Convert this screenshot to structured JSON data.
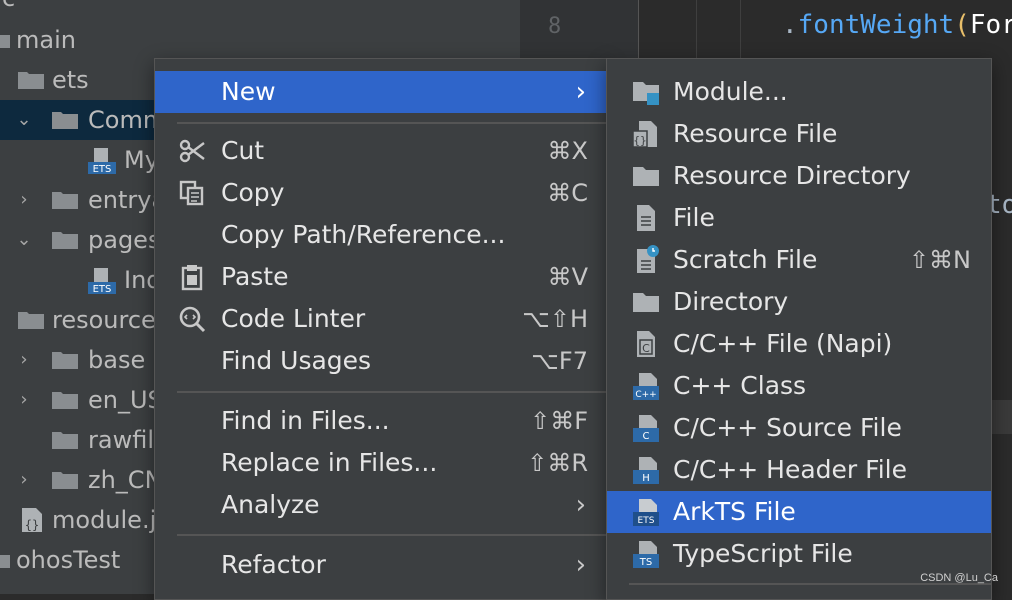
{
  "tree": {
    "top_partial": "c",
    "main": "main",
    "ets": "ets",
    "common": "Comm",
    "my_file": "My",
    "entry": "entrya",
    "pages": "pages",
    "index_file": "Ind",
    "resources": "resource",
    "base": "base",
    "en_us": "en_US",
    "rawfile": "rawfile",
    "zh_cn": "zh_CN",
    "module_json": "module.js",
    "ohostest": "ohosTest",
    "ets_badge": "ETS"
  },
  "editor": {
    "line_number": "8",
    "code_dot": ".",
    "code_fn": "fontWeight",
    "code_paren": "(",
    "code_arg": "For",
    "code_fragment": "to"
  },
  "context_menu": {
    "new": "New",
    "cut": "Cut",
    "cut_shortcut": "⌘X",
    "copy": "Copy",
    "copy_shortcut": "⌘C",
    "copy_path": "Copy Path/Reference...",
    "paste": "Paste",
    "paste_shortcut": "⌘V",
    "code_linter": "Code Linter",
    "code_linter_shortcut": "⌥⇧H",
    "find_usages": "Find Usages",
    "find_usages_shortcut": "⌥F7",
    "find_in_files": "Find in Files...",
    "find_in_files_shortcut": "⇧⌘F",
    "replace_in_files": "Replace in Files...",
    "replace_in_files_shortcut": "⇧⌘R",
    "analyze": "Analyze",
    "refactor": "Refactor"
  },
  "new_submenu": {
    "module": "Module...",
    "resource_file": "Resource File",
    "resource_directory": "Resource Directory",
    "file": "File",
    "scratch_file": "Scratch File",
    "scratch_file_shortcut": "⇧⌘N",
    "directory": "Directory",
    "c_cpp_napi": "C/C++ File (Napi)",
    "cpp_class": "C++ Class",
    "c_cpp_source": "C/C++ Source File",
    "c_cpp_header": "C/C++ Header File",
    "arkts_file": "ArkTS File",
    "typescript_file": "TypeScript File",
    "icon_badges": {
      "napi": "C",
      "cpp": "C++",
      "source": "C",
      "header": "H",
      "arkts": "ETS",
      "ts": "TS"
    }
  },
  "watermark": "CSDN @Lu_Ca",
  "colors": {
    "menu_bg": "#3c3f41",
    "highlight": "#2f65ca",
    "tree_selected": "#0d293e",
    "editor_bg": "#2b2b2b",
    "fn_blue": "#56a8f5",
    "paren_yellow": "#e8bf6a"
  }
}
